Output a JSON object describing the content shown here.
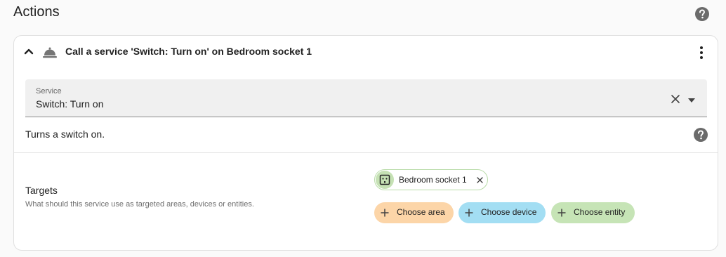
{
  "header": {
    "title": "Actions",
    "help_icon": "help-circle-icon"
  },
  "action": {
    "title": "Call a service 'Switch: Turn on' on Bedroom socket 1",
    "icon": "service-bell-icon",
    "expanded": true,
    "service_field": {
      "label": "Service",
      "value": "Switch: Turn on"
    },
    "description": "Turns a switch on.",
    "targets": {
      "title": "Targets",
      "subtitle": "What should this service use as targeted areas, devices or entities.",
      "selected": [
        {
          "label": "Bedroom socket 1",
          "icon": "power-socket-icon",
          "color": "#c5e1b4"
        }
      ],
      "add_buttons": {
        "area": {
          "label": "Choose area",
          "color": "#fcd5a8"
        },
        "device": {
          "label": "Choose device",
          "color": "#a3def3"
        },
        "entity": {
          "label": "Choose entity",
          "color": "#c6e4b6"
        }
      }
    }
  }
}
